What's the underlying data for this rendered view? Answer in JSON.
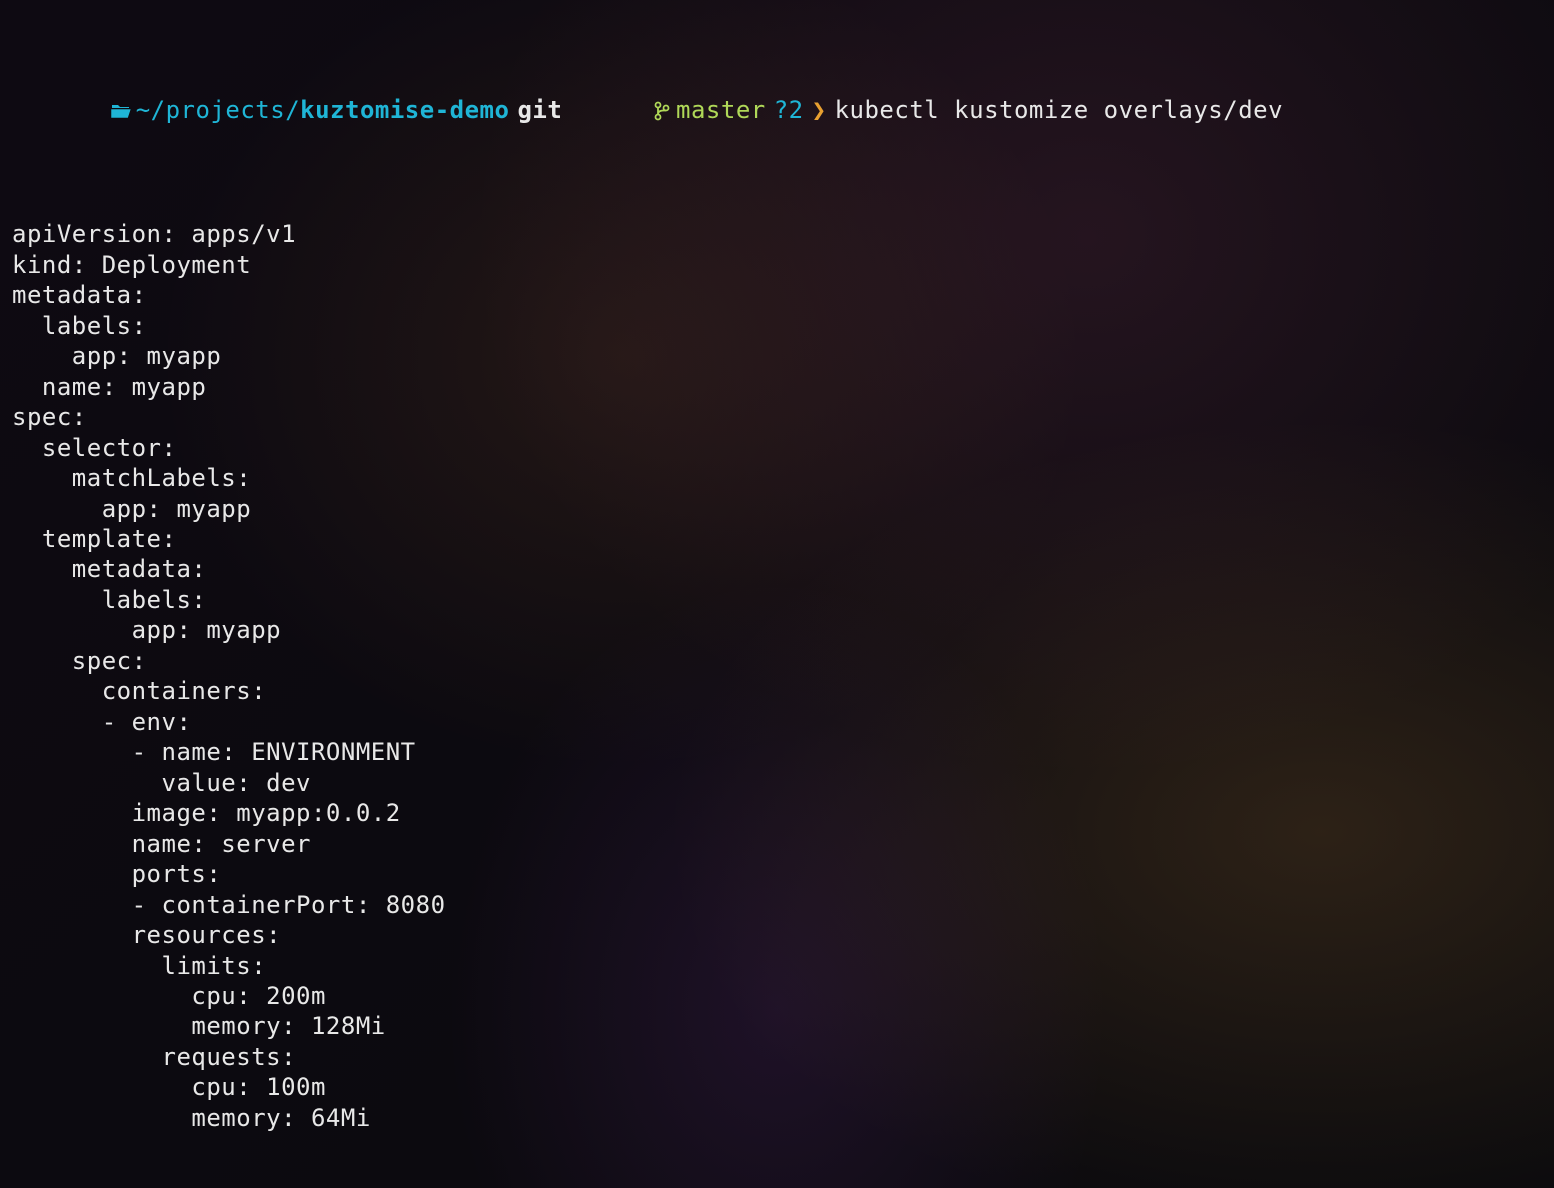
{
  "prompt": {
    "apple_glyph": "",
    "folder_glyph": "📂",
    "path_prefix": "~/projects/",
    "project_name": "kuztomise-demo",
    "git_label": "git",
    "branch_glyph": "ᚴ",
    "branch_name": "master",
    "status_flag": "?2",
    "arrow_glyph": "❯",
    "command": "kubectl kustomize overlays/dev"
  },
  "output_lines": [
    "apiVersion: apps/v1",
    "kind: Deployment",
    "metadata:",
    "  labels:",
    "    app: myapp",
    "  name: myapp",
    "spec:",
    "  selector:",
    "    matchLabels:",
    "      app: myapp",
    "  template:",
    "    metadata:",
    "      labels:",
    "        app: myapp",
    "    spec:",
    "      containers:",
    "      - env:",
    "        - name: ENVIRONMENT",
    "          value: dev",
    "        image: myapp:0.0.2",
    "        name: server",
    "        ports:",
    "        - containerPort: 8080",
    "        resources:",
    "          limits:",
    "            cpu: 200m",
    "            memory: 128Mi",
    "          requests:",
    "            cpu: 100m",
    "            memory: 64Mi"
  ]
}
